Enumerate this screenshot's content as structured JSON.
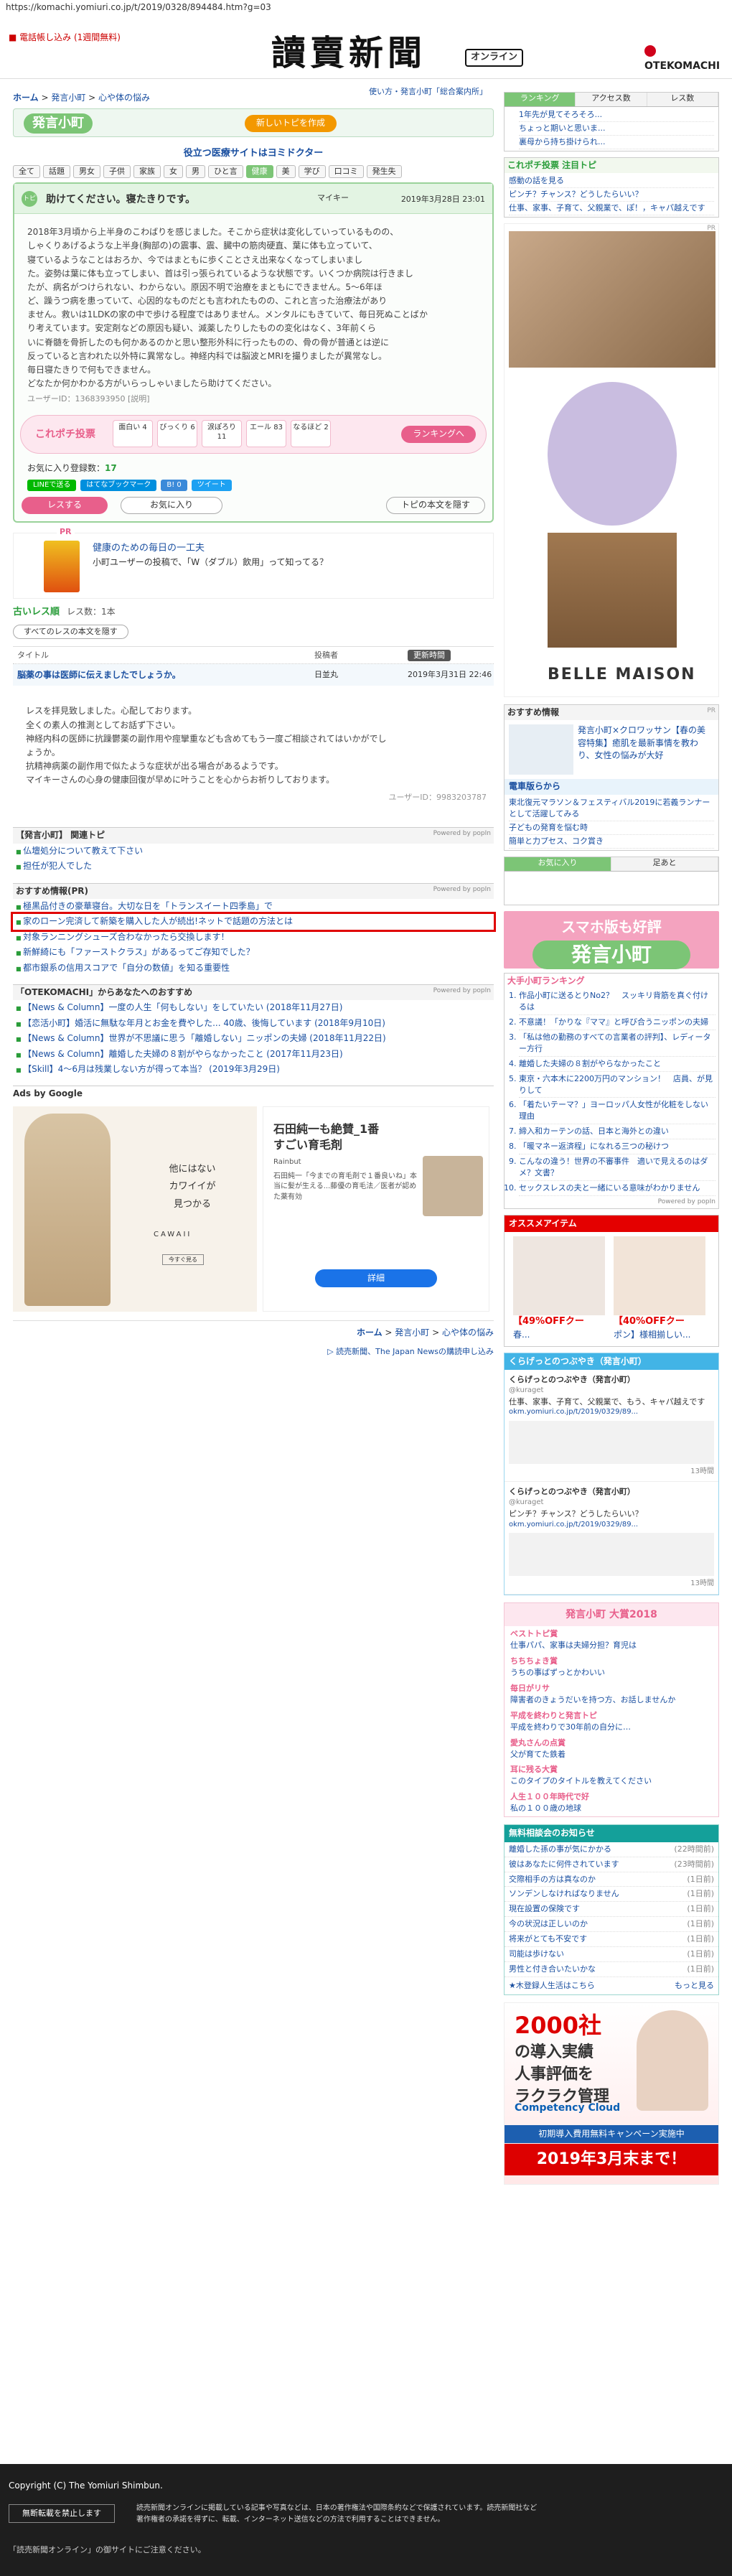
{
  "browser": {
    "url": "https://komachi.yomiuri.co.jp/t/2019/0328/894484.htm?g=03"
  },
  "header": {
    "register": "■ 電話帳し込み (1週間無料)",
    "logo": "讀賣新聞",
    "online": "オンライン",
    "otekomachi": "OTEKOMACHI"
  },
  "breadcrumb": {
    "home": "ホーム",
    "sep1": " > ",
    "komachi": "発言小町",
    "sep2": " > ",
    "category": "心や体の悩み"
  },
  "topbar": {
    "links": "使い方・発言小町「総合案内所」",
    "logo": "発言小町",
    "new_topic": "新しいトピを作成"
  },
  "sponsor": "役立つ医療サイトはヨミドクター",
  "tabs": [
    "全て",
    "話題",
    "男女",
    "子供",
    "家族",
    "女",
    "男",
    "ひと言",
    "健康",
    "美",
    "学び",
    "口コミ",
    "発生失"
  ],
  "topic": {
    "badge": "トピ",
    "title": "助けてください。寝たきりです。",
    "author": "マイキー",
    "date": "2019年3月28日 23:01",
    "body": "2018年3月頃から上半身のこわばりを感じました。そこから症状は変化していっているものの、\nしゃくりあげるような上半身(胸部の)の震事、震、臓中の筋肉硬直、葉に体も立っていて、\n寝ているようなことはおろか、今ではまともに歩くことさえ出来なくなってしまいまし\nた。姿勢は葉に体も立ってしまい、首は引っ張られているような状態です。いくつか病院は行きまし\nたが、病名がつけられない、わからない。原因不明で治療をまともにできません。5〜6年ほ\nど、躁うつ病を患っていて、心因的なものだとも言われたものの、これと言った治療法があり\nません。救いは1LDKの家の中で歩ける程度ではありません。メンタルにもきていて、毎日死ぬことばか\nり考えています。安定剤などの原因も疑い、減薬したりしたものの変化はなく、3年前くら\nいに脊髄を骨折したのも何かあるのかと思い整形外科に行ったものの、骨の骨が普通とは逆に\n反っていると言われた以外特に異常なし。神経内科では脳波とMRIを撮りましたが異常なし。\n毎日寝たきりで何もできません。\nどなたか何かわかる方がいらっしゃいましたら助けてください。",
    "uid": "ユーザーID：1368393950 [説明]",
    "poll": {
      "label": "これポチ投票",
      "items": [
        "面白い\n4",
        "びっくり\n6",
        "涙ぽろり\n11",
        "エール\n83",
        "なるほど\n2"
      ],
      "ranking": "ランキングへ"
    },
    "favs_label": "お気に入り登録数：",
    "favs": "17",
    "share": [
      "LINEで送る",
      "はてなブックマーク",
      "B! 0",
      "ツイート"
    ],
    "reply": "レスする",
    "fav": "お気に入り",
    "back": "トピの本文を隠す"
  },
  "ad1": {
    "pr": "PR",
    "title": "健康のための毎日の一工夫",
    "sub": "小町ユーザーの投稿で、「W（ダブル）飲用」って知ってる？"
  },
  "responses": {
    "title": "古いレス順",
    "count": "レス数：1本",
    "all": "すべてのレスの本文を隠す",
    "col_title": "タイトル",
    "col_author": "投稿者",
    "col_sort": "更新時間",
    "row_title": "脳薬の事は医師に伝えましたでしょうか。",
    "row_author": "日並丸",
    "row_date": "2019年3月31日 22:46",
    "body": "レスを拝見致しました。心配しております。\n全くの素人の推測としてお話ず下さい。\n神経内科の医師に抗躁鬱薬の副作用や痙攣重なども含めてもう一度ご相談されてはいかがでし\nょうか。\n抗精神病薬の副作用で似たような症状が出る場合があるようです。\nマイキーさんの心身の健康回復が早めに叶うことを心からお祈りしております。",
    "uid": "ユーザーID：9983203787"
  },
  "related": {
    "title": "【発言小町】 関連トピ",
    "by": "Powered by popIn",
    "items": [
      "仏壇処分について教えて下さい",
      "担任が犯人でした"
    ]
  },
  "osusume": {
    "title": "おすすめ情報(PR)",
    "by": "Powered by popIn",
    "items": [
      "極黒品付きの豪華寝台。大切な日を「トランスイート四季島」で",
      "家のローン完済して新築を購入した人が続出!ネットで話題の方法とは",
      "対象ランニングシューズ合わなかったら交換します！",
      "新鮮綺にも「ファーストクラス」があるってご存知でした？",
      "都市銀系の信用スコアで「自分の数値」を知る重要性"
    ]
  },
  "otekomachi": {
    "title": "「OTEKOMACHI」からあなたへのおすすめ",
    "by": "Powered by popIn",
    "items": [
      "【News & Column】一度の人生「何もしない」をしていたい (2018年11月27日)",
      "【恋活小町】婚活に無駄な年月とお金を費やした... 40歳、後悔しています (2018年9月10日)",
      "【News & Column】世界が不思議に思う「離婚しない」ニッポンの夫婦 (2018年11月22日)",
      "【News & Column】離婚した夫婦の８割がやらなかったこと (2017年11月23日)",
      "【Skill】4〜6月は残業しない方が得って本当？ (2019年3月29日)"
    ]
  },
  "adsgoogle": {
    "label": "Ads by Google",
    "d1": "他にはない\nカワイイが\n見つかる",
    "d2": "CAWAII",
    "d3": "今すぐ見る",
    "h1": "石田純一も絶賛_1番\nすごい育毛剤",
    "h2": "Rainbut",
    "h3": "石田純一「今までの育毛剤で１番良いね」本当に髪が生える...藤優の育毛法／医者が認めた薬有効",
    "btn": "詳細"
  },
  "bottom": {
    "home": "ホーム",
    "sep": " > ",
    "komachi": "発言小町",
    "cat": "心や体の悩み",
    "links": "▷ 読売新聞、The Japan Newsの購読申し込み"
  },
  "footer": {
    "copyright": "Copyright (C) The Yomiuri Shimbun.",
    "btn": "無断転載を禁止します",
    "desc": "読売新聞オンラインに掲載している記事や写真などは、日本の著作権法や国際条約などで保護されています。読売新聞社など著作権者の承諾を得ずに、転載、インターネット送信などの方法で利用することはできません。",
    "contact": "「読売新聞オンライン」の御サイトにご注意ください。"
  },
  "side": {
    "rank": {
      "tabs": [
        "ランキング",
        "アクセス数",
        "レス数"
      ],
      "items": [
        "1年先が見てそろそろ...",
        "ちょっと期いと思いま...",
        "裏母から持ち掛けられ..."
      ]
    },
    "kore": {
      "title": "これポチ投票 注目トピ",
      "items": [
        "感動の話を見る",
        "ピンチ？チャンス？どうしたらいい？",
        "仕事、家事、子育て、父親業で、ぽ！，キャパ越えです"
      ]
    },
    "photoad": {
      "pr": "PR",
      "brand": "BELLE MAISON"
    },
    "info": {
      "title": "おすすめ情報",
      "pr": "PR",
      "a": "発言小町×クロワッサン【春の美容特集】癒肌を最新事情を教わり、女性の悩みが大好",
      "b": "電車版らから",
      "c1": "東北復元マラソン＆フェスティバル2019に若義ランナーとして活躍してみる",
      "c2": "子どもの発育を悩む時",
      "c3": "簡単と力プセス、コク賞き"
    },
    "tabs2": [
      "お気に入り",
      "足あと"
    ],
    "banner": {
      "t1": "スマホ版も好評",
      "t2": "発言小町"
    },
    "rank2": {
      "title": "大手小町ランキング",
      "items": [
        "作品小町に送るとりNo2？　スッキリ背筋を真ぐ付けるは",
        "不意議！「かりな『ママ』と呼び合うニッポンの夫婦",
        "「私は他の勤務のすべての言業者の評判】、レディーター方行",
        "離婚した夫婦の８割がやらなかったこと",
        "東京・六本木に2200万円のマンション！　店員、が見りして",
        "「着たいテーマ？」ヨーロッパ人女性が化粧をしない理由",
        "締入和カーテンの話、日本と海外との違い",
        "「暖マネー返済程」になれる三つの秘けつ",
        "こんなの違う！世界の不審事件　適いで見えるのはダメ？文書？",
        "セックスレスの夫と一緒にいる意味がわかりません"
      ],
      "by": "Powered by popIn"
    },
    "items": {
      "title": "オススメアイテム",
      "p1": "【49%OFFクー",
      "p1b": "春...",
      "p2": "【40%OFFクー",
      "p2b": "ポン】様相揃しい..."
    },
    "twitter": {
      "title": "くらげっとのつぶやき（発言小町）",
      "user": "くらげっとのつぶやき（発言小町）",
      "handle": "@kuraget",
      "t1": "仕事、家事、子育て、父親業で、もう、キャパ越えです",
      "u1": "okm.yomiuri.co.jp/t/2019/0329/89...",
      "r1": "13時間",
      "t2": "ピンチ？チャンス？どうしたらいい？",
      "u2": "okm.yomiuri.co.jp/t/2019/0329/89...",
      "r2": "13時間"
    },
    "taisho": {
      "title": "発言小町 大賞2018",
      "items": [
        "ベストトピ賞",
        "仕事パパ、家事は夫婦分担？育児は",
        "ちちちょき賞",
        "うちの事ばずっとかわいい",
        "毎日がリサ",
        "障害者のきょうだいを持つ方、お話しませんか",
        "平成を終わりと発言トピ",
        "平成を終わりで30年前の自分に…",
        "愛丸さんの点賞",
        "父が育てた鉄着",
        "耳に残る大賞",
        "このタイプのタイトルを教えてください",
        "人生１００年時代で好",
        "私の１００歳の地球"
      ]
    },
    "muryou": {
      "title": "無料相談会のお知らせ",
      "items": [
        [
          "離婚した孫の事が気にかかる",
          "(22時間前)"
        ],
        [
          "彼はあなたに何件されています",
          "(23時間前)"
        ],
        [
          "交際相手の方は真なのか",
          "(1日前)"
        ],
        [
          "ソンデンしなければなりません",
          "(1日前)"
        ],
        [
          "現在設置の保険です",
          "(1日前)"
        ],
        [
          "今の状況は正しいのか",
          "(1日前)"
        ],
        [
          "将来がとても不安です",
          "(1日前)"
        ],
        [
          "司能は歩けない",
          "(1日前)"
        ],
        [
          "男性と付き合いたいかな",
          "(1日前)"
        ]
      ],
      "footer_l": "★木登録人生活はこちら",
      "footer_r": "もっと見る"
    },
    "bigad": {
      "b1": "2000社",
      "b2": "の導入実績\n人事評価を\nラクラク管理",
      "b3": "Competency Cloud",
      "b4": "初期導入費用無料キャンペーン実施中",
      "b5": "2019年3月末まで！"
    }
  }
}
